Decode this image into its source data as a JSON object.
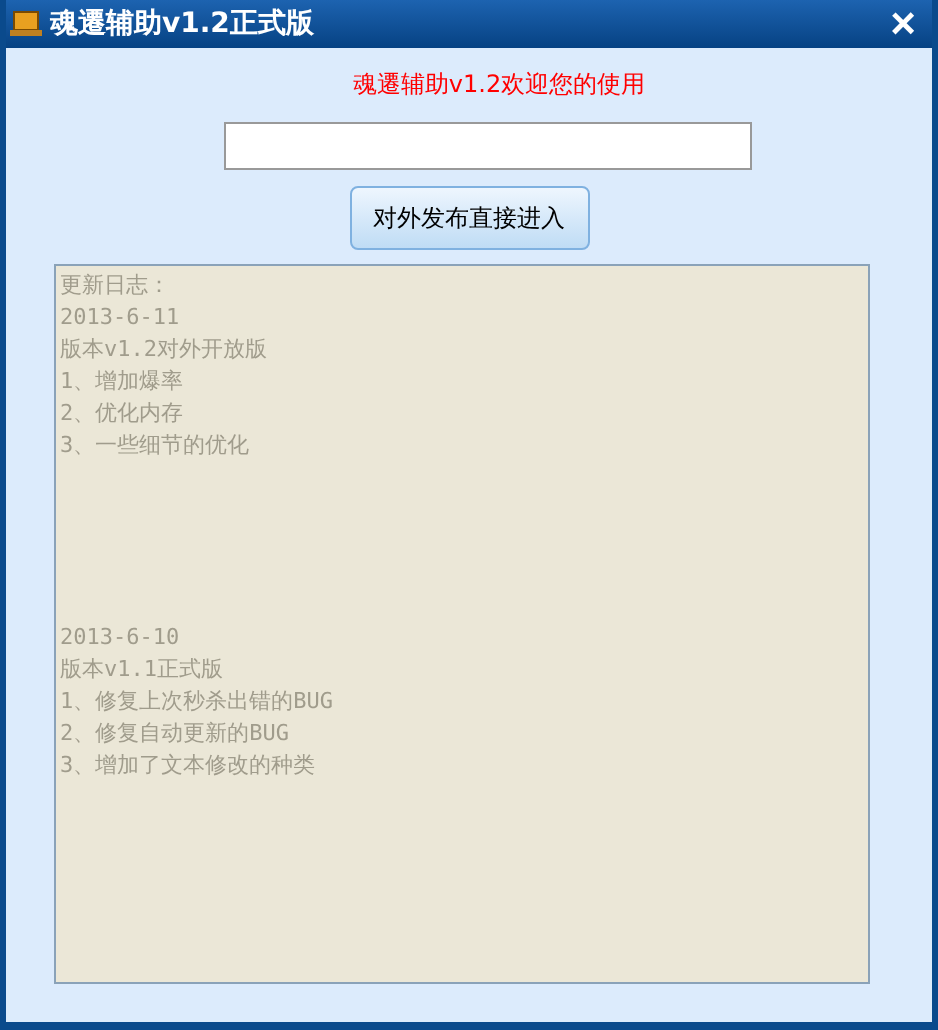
{
  "window": {
    "title": "魂遷辅助v1.2正式版",
    "close": "×"
  },
  "welcome": "魂遷辅助v1.2欢迎您的使用",
  "button": "对外发布直接进入",
  "log": {
    "sections": [
      [
        "更新日志：",
        "2013-6-11",
        "版本v1.2对外开放版",
        "1、增加爆率",
        "2、优化内存",
        "3、一些细节的优化"
      ],
      [
        "2013-6-10",
        "版本v1.1正式版",
        "1、修复上次秒杀出错的BUG",
        "2、修复自动更新的BUG",
        "3、增加了文本修改的种类"
      ]
    ]
  }
}
